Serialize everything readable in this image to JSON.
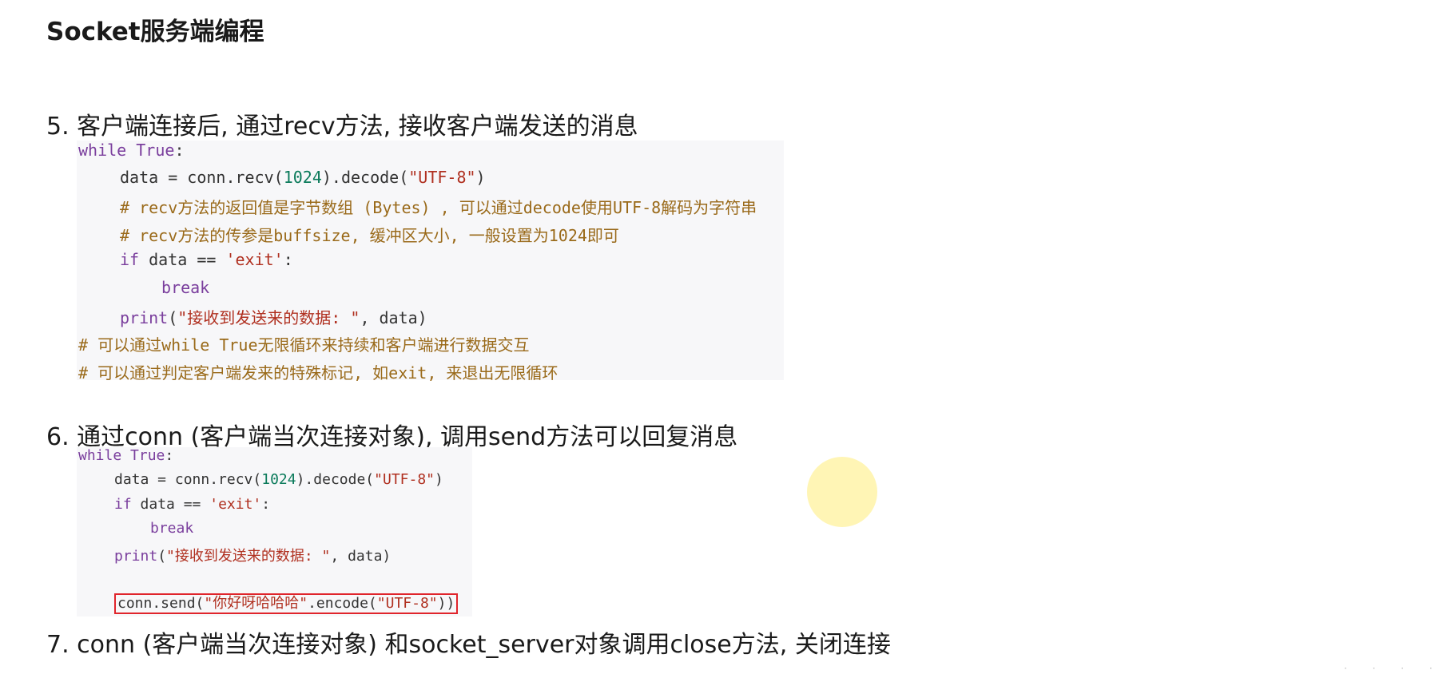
{
  "title": "Socket服务端编程",
  "steps": {
    "s5": "5. 客户端连接后, 通过recv方法, 接收客户端发送的消息",
    "s6": "6. 通过conn (客户端当次连接对象), 调用send方法可以回复消息",
    "s7": "7. conn (客户端当次连接对象) 和socket_server对象调用close方法, 关闭连接"
  },
  "code1": {
    "l1_kw": "while",
    "l1_true": "True",
    "l1_rest": ":",
    "l2_a": "data = conn.recv(",
    "l2_num": "1024",
    "l2_b": ").decode(",
    "l2_str": "\"UTF-8\"",
    "l2_c": ")",
    "l3": "# recv方法的返回值是字节数组 (Bytes) , 可以通过decode使用UTF-8解码为字符串",
    "l4": "# recv方法的传参是buffsize, 缓冲区大小, 一般设置为1024即可",
    "l5_kw": "if",
    "l5_a": " data == ",
    "l5_str": "'exit'",
    "l5_b": ":",
    "l6_kw": "break",
    "l7_fn": "print",
    "l7_a": "(",
    "l7_str": "\"接收到发送来的数据: \"",
    "l7_b": ", data)",
    "l8": "# 可以通过while True无限循环来持续和客户端进行数据交互",
    "l9": "# 可以通过判定客户端发来的特殊标记, 如exit, 来退出无限循环"
  },
  "code2": {
    "l1_kw": "while",
    "l1_true": "True",
    "l1_rest": ":",
    "l2_a": "data = conn.recv(",
    "l2_num": "1024",
    "l2_b": ").decode(",
    "l2_str": "\"UTF-8\"",
    "l2_c": ")",
    "l3_kw": "if",
    "l3_a": " data == ",
    "l3_str": "'exit'",
    "l3_b": ":",
    "l4_kw": "break",
    "l5_fn": "print",
    "l5_a": "(",
    "l5_str": "\"接收到发送来的数据: \"",
    "l5_b": ", data)",
    "l6_a": "conn.send(",
    "l6_str": "\"你好呀哈哈哈\"",
    "l6_b": ".encode(",
    "l6_str2": "\"UTF-8\"",
    "l6_c": "))"
  }
}
